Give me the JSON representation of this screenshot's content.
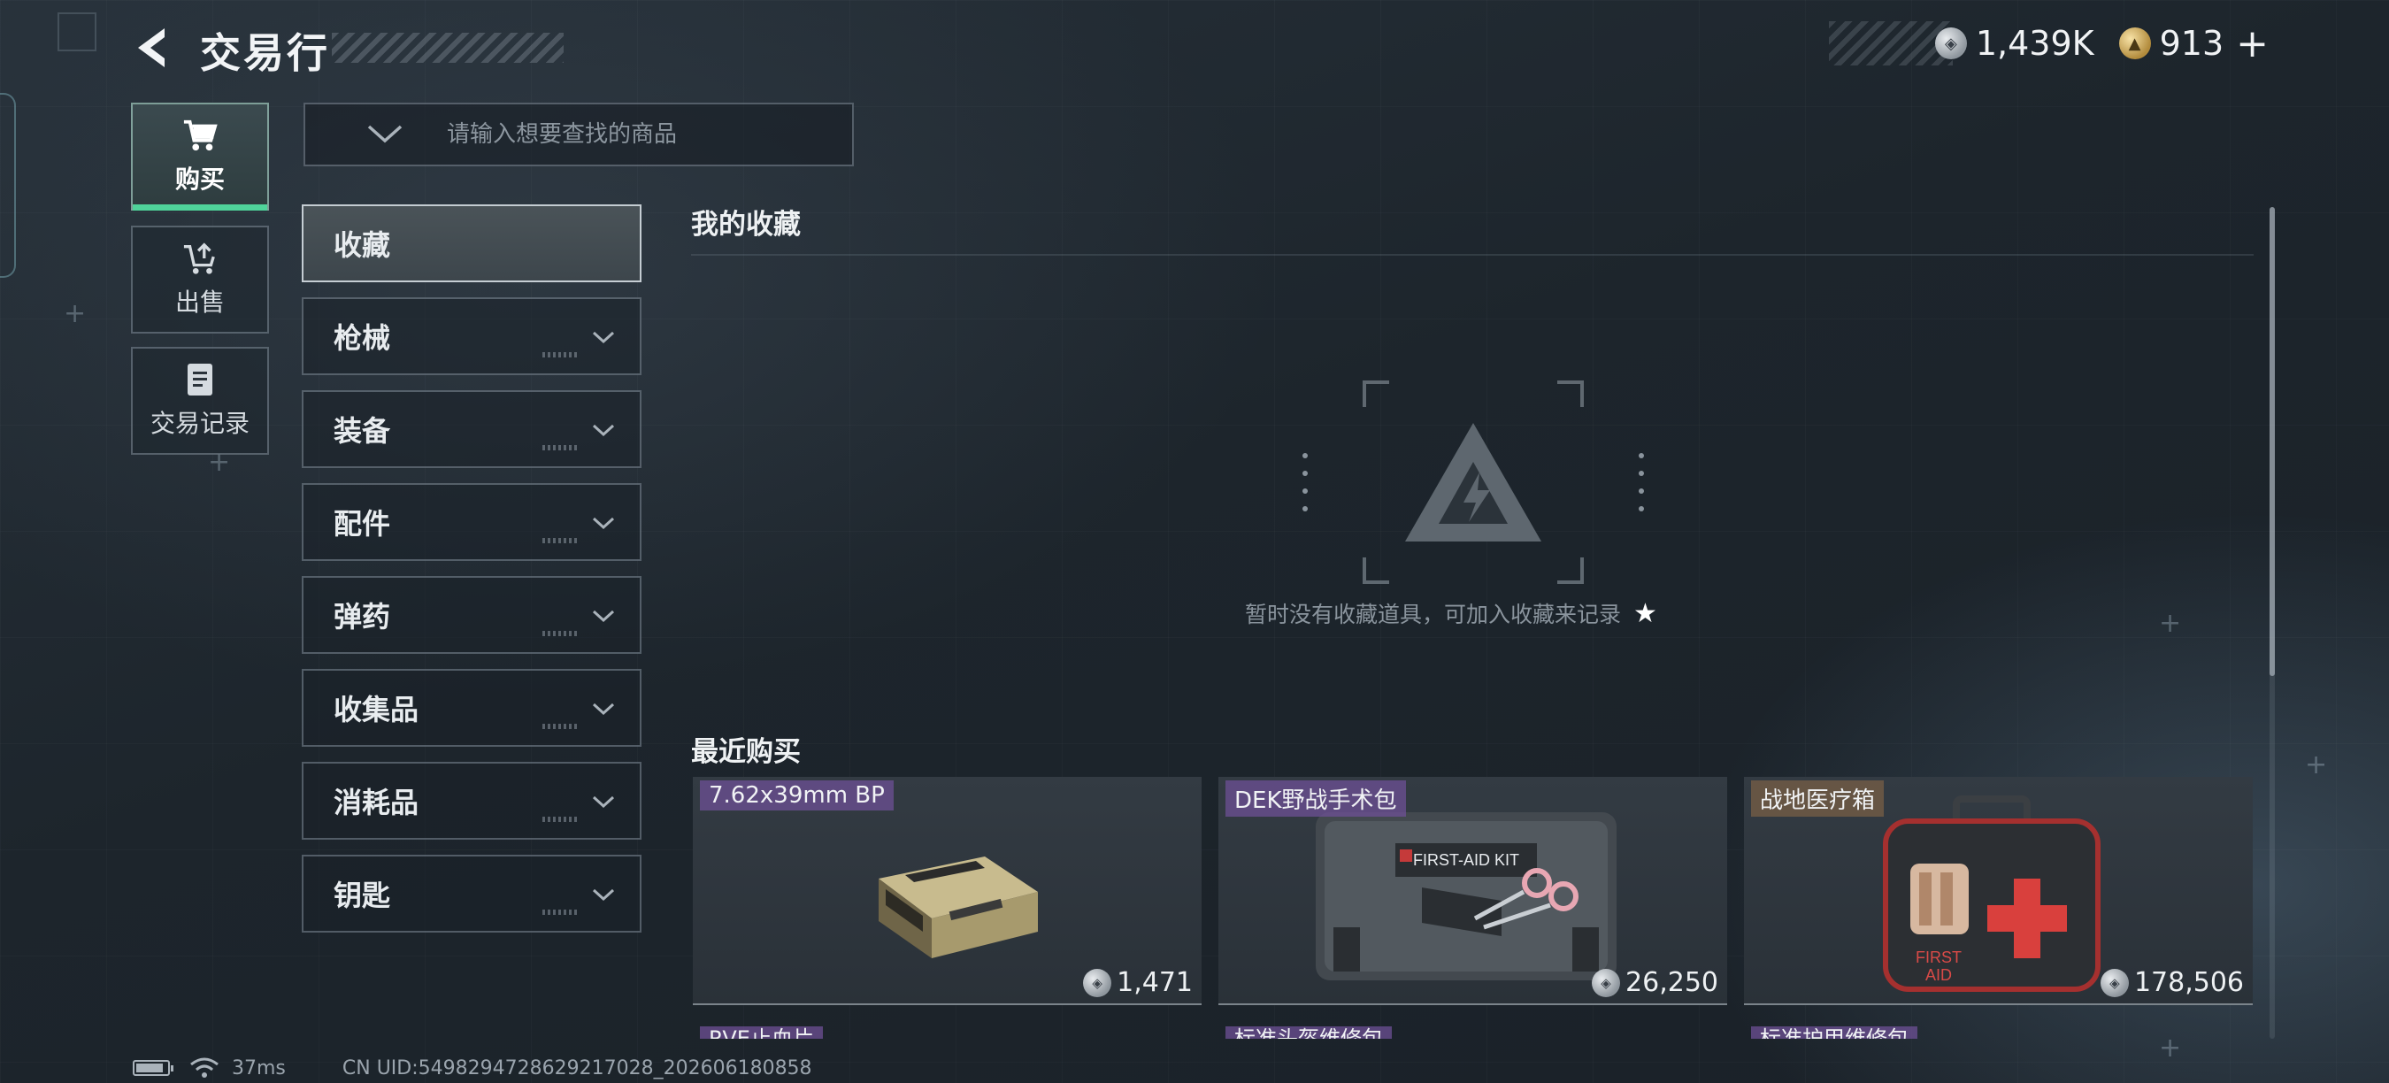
{
  "header": {
    "title": "交易行",
    "currency": [
      {
        "type": "silver",
        "amount": "1,439K"
      },
      {
        "type": "gold",
        "amount": "913"
      }
    ],
    "add_label": "+"
  },
  "nav": {
    "tabs": [
      {
        "label": "购买",
        "icon": "cart-icon",
        "active": true
      },
      {
        "label": "出售",
        "icon": "sell-icon",
        "active": false
      },
      {
        "label": "交易记录",
        "icon": "record-icon",
        "active": false
      }
    ]
  },
  "search": {
    "placeholder": "请输入想要查找的商品",
    "value": ""
  },
  "categories": [
    {
      "label": "收藏",
      "selected": true,
      "expandable": false
    },
    {
      "label": "枪械",
      "selected": false,
      "expandable": true
    },
    {
      "label": "装备",
      "selected": false,
      "expandable": true
    },
    {
      "label": "配件",
      "selected": false,
      "expandable": true
    },
    {
      "label": "弹药",
      "selected": false,
      "expandable": true
    },
    {
      "label": "收集品",
      "selected": false,
      "expandable": true
    },
    {
      "label": "消耗品",
      "selected": false,
      "expandable": true
    },
    {
      "label": "钥匙",
      "selected": false,
      "expandable": true
    }
  ],
  "favorites": {
    "title": "我的收藏",
    "empty_message": "暂时没有收藏道具，可加入收藏来记录",
    "empty_icon": "star-icon"
  },
  "recent": {
    "title": "最近购买",
    "items": [
      {
        "name": "7.62x39mm BP",
        "price": "1,471",
        "tag_color": "#6e5096",
        "art": "ammo-box"
      },
      {
        "name": "DEK野战手术包",
        "price": "26,250",
        "tag_color": "#6e5096",
        "art": "surgical-kit"
      },
      {
        "name": "战地医疗箱",
        "price": "178,506",
        "tag_color": "#785f46",
        "art": "medical-case"
      }
    ],
    "next_row": [
      "RVE止血片",
      "标准头盔维修包",
      "标准护甲维修包"
    ]
  },
  "status_bar": {
    "ping": "37ms",
    "uid": "CN UID:5498294728629217028_202606180858"
  }
}
